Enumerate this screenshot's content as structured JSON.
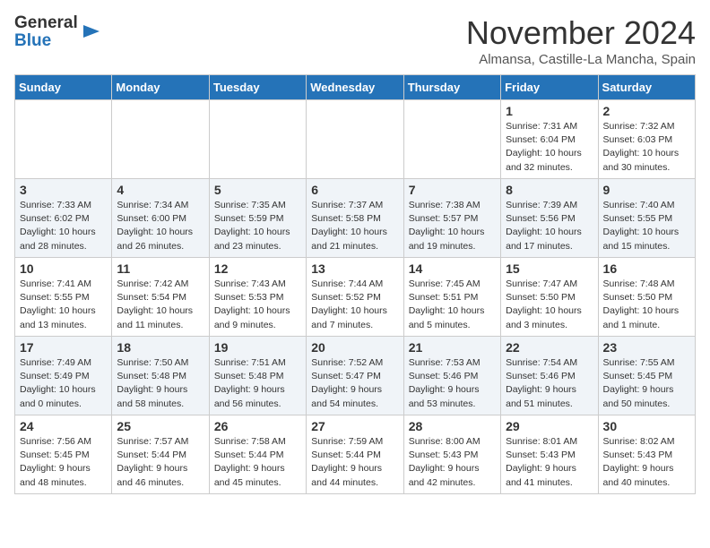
{
  "header": {
    "logo_line1": "General",
    "logo_line2": "Blue",
    "month": "November 2024",
    "location": "Almansa, Castille-La Mancha, Spain"
  },
  "weekdays": [
    "Sunday",
    "Monday",
    "Tuesday",
    "Wednesday",
    "Thursday",
    "Friday",
    "Saturday"
  ],
  "weeks": [
    [
      {
        "day": "",
        "info": ""
      },
      {
        "day": "",
        "info": ""
      },
      {
        "day": "",
        "info": ""
      },
      {
        "day": "",
        "info": ""
      },
      {
        "day": "",
        "info": ""
      },
      {
        "day": "1",
        "info": "Sunrise: 7:31 AM\nSunset: 6:04 PM\nDaylight: 10 hours\nand 32 minutes."
      },
      {
        "day": "2",
        "info": "Sunrise: 7:32 AM\nSunset: 6:03 PM\nDaylight: 10 hours\nand 30 minutes."
      }
    ],
    [
      {
        "day": "3",
        "info": "Sunrise: 7:33 AM\nSunset: 6:02 PM\nDaylight: 10 hours\nand 28 minutes."
      },
      {
        "day": "4",
        "info": "Sunrise: 7:34 AM\nSunset: 6:00 PM\nDaylight: 10 hours\nand 26 minutes."
      },
      {
        "day": "5",
        "info": "Sunrise: 7:35 AM\nSunset: 5:59 PM\nDaylight: 10 hours\nand 23 minutes."
      },
      {
        "day": "6",
        "info": "Sunrise: 7:37 AM\nSunset: 5:58 PM\nDaylight: 10 hours\nand 21 minutes."
      },
      {
        "day": "7",
        "info": "Sunrise: 7:38 AM\nSunset: 5:57 PM\nDaylight: 10 hours\nand 19 minutes."
      },
      {
        "day": "8",
        "info": "Sunrise: 7:39 AM\nSunset: 5:56 PM\nDaylight: 10 hours\nand 17 minutes."
      },
      {
        "day": "9",
        "info": "Sunrise: 7:40 AM\nSunset: 5:55 PM\nDaylight: 10 hours\nand 15 minutes."
      }
    ],
    [
      {
        "day": "10",
        "info": "Sunrise: 7:41 AM\nSunset: 5:55 PM\nDaylight: 10 hours\nand 13 minutes."
      },
      {
        "day": "11",
        "info": "Sunrise: 7:42 AM\nSunset: 5:54 PM\nDaylight: 10 hours\nand 11 minutes."
      },
      {
        "day": "12",
        "info": "Sunrise: 7:43 AM\nSunset: 5:53 PM\nDaylight: 10 hours\nand 9 minutes."
      },
      {
        "day": "13",
        "info": "Sunrise: 7:44 AM\nSunset: 5:52 PM\nDaylight: 10 hours\nand 7 minutes."
      },
      {
        "day": "14",
        "info": "Sunrise: 7:45 AM\nSunset: 5:51 PM\nDaylight: 10 hours\nand 5 minutes."
      },
      {
        "day": "15",
        "info": "Sunrise: 7:47 AM\nSunset: 5:50 PM\nDaylight: 10 hours\nand 3 minutes."
      },
      {
        "day": "16",
        "info": "Sunrise: 7:48 AM\nSunset: 5:50 PM\nDaylight: 10 hours\nand 1 minute."
      }
    ],
    [
      {
        "day": "17",
        "info": "Sunrise: 7:49 AM\nSunset: 5:49 PM\nDaylight: 10 hours\nand 0 minutes."
      },
      {
        "day": "18",
        "info": "Sunrise: 7:50 AM\nSunset: 5:48 PM\nDaylight: 9 hours\nand 58 minutes."
      },
      {
        "day": "19",
        "info": "Sunrise: 7:51 AM\nSunset: 5:48 PM\nDaylight: 9 hours\nand 56 minutes."
      },
      {
        "day": "20",
        "info": "Sunrise: 7:52 AM\nSunset: 5:47 PM\nDaylight: 9 hours\nand 54 minutes."
      },
      {
        "day": "21",
        "info": "Sunrise: 7:53 AM\nSunset: 5:46 PM\nDaylight: 9 hours\nand 53 minutes."
      },
      {
        "day": "22",
        "info": "Sunrise: 7:54 AM\nSunset: 5:46 PM\nDaylight: 9 hours\nand 51 minutes."
      },
      {
        "day": "23",
        "info": "Sunrise: 7:55 AM\nSunset: 5:45 PM\nDaylight: 9 hours\nand 50 minutes."
      }
    ],
    [
      {
        "day": "24",
        "info": "Sunrise: 7:56 AM\nSunset: 5:45 PM\nDaylight: 9 hours\nand 48 minutes."
      },
      {
        "day": "25",
        "info": "Sunrise: 7:57 AM\nSunset: 5:44 PM\nDaylight: 9 hours\nand 46 minutes."
      },
      {
        "day": "26",
        "info": "Sunrise: 7:58 AM\nSunset: 5:44 PM\nDaylight: 9 hours\nand 45 minutes."
      },
      {
        "day": "27",
        "info": "Sunrise: 7:59 AM\nSunset: 5:44 PM\nDaylight: 9 hours\nand 44 minutes."
      },
      {
        "day": "28",
        "info": "Sunrise: 8:00 AM\nSunset: 5:43 PM\nDaylight: 9 hours\nand 42 minutes."
      },
      {
        "day": "29",
        "info": "Sunrise: 8:01 AM\nSunset: 5:43 PM\nDaylight: 9 hours\nand 41 minutes."
      },
      {
        "day": "30",
        "info": "Sunrise: 8:02 AM\nSunset: 5:43 PM\nDaylight: 9 hours\nand 40 minutes."
      }
    ]
  ]
}
